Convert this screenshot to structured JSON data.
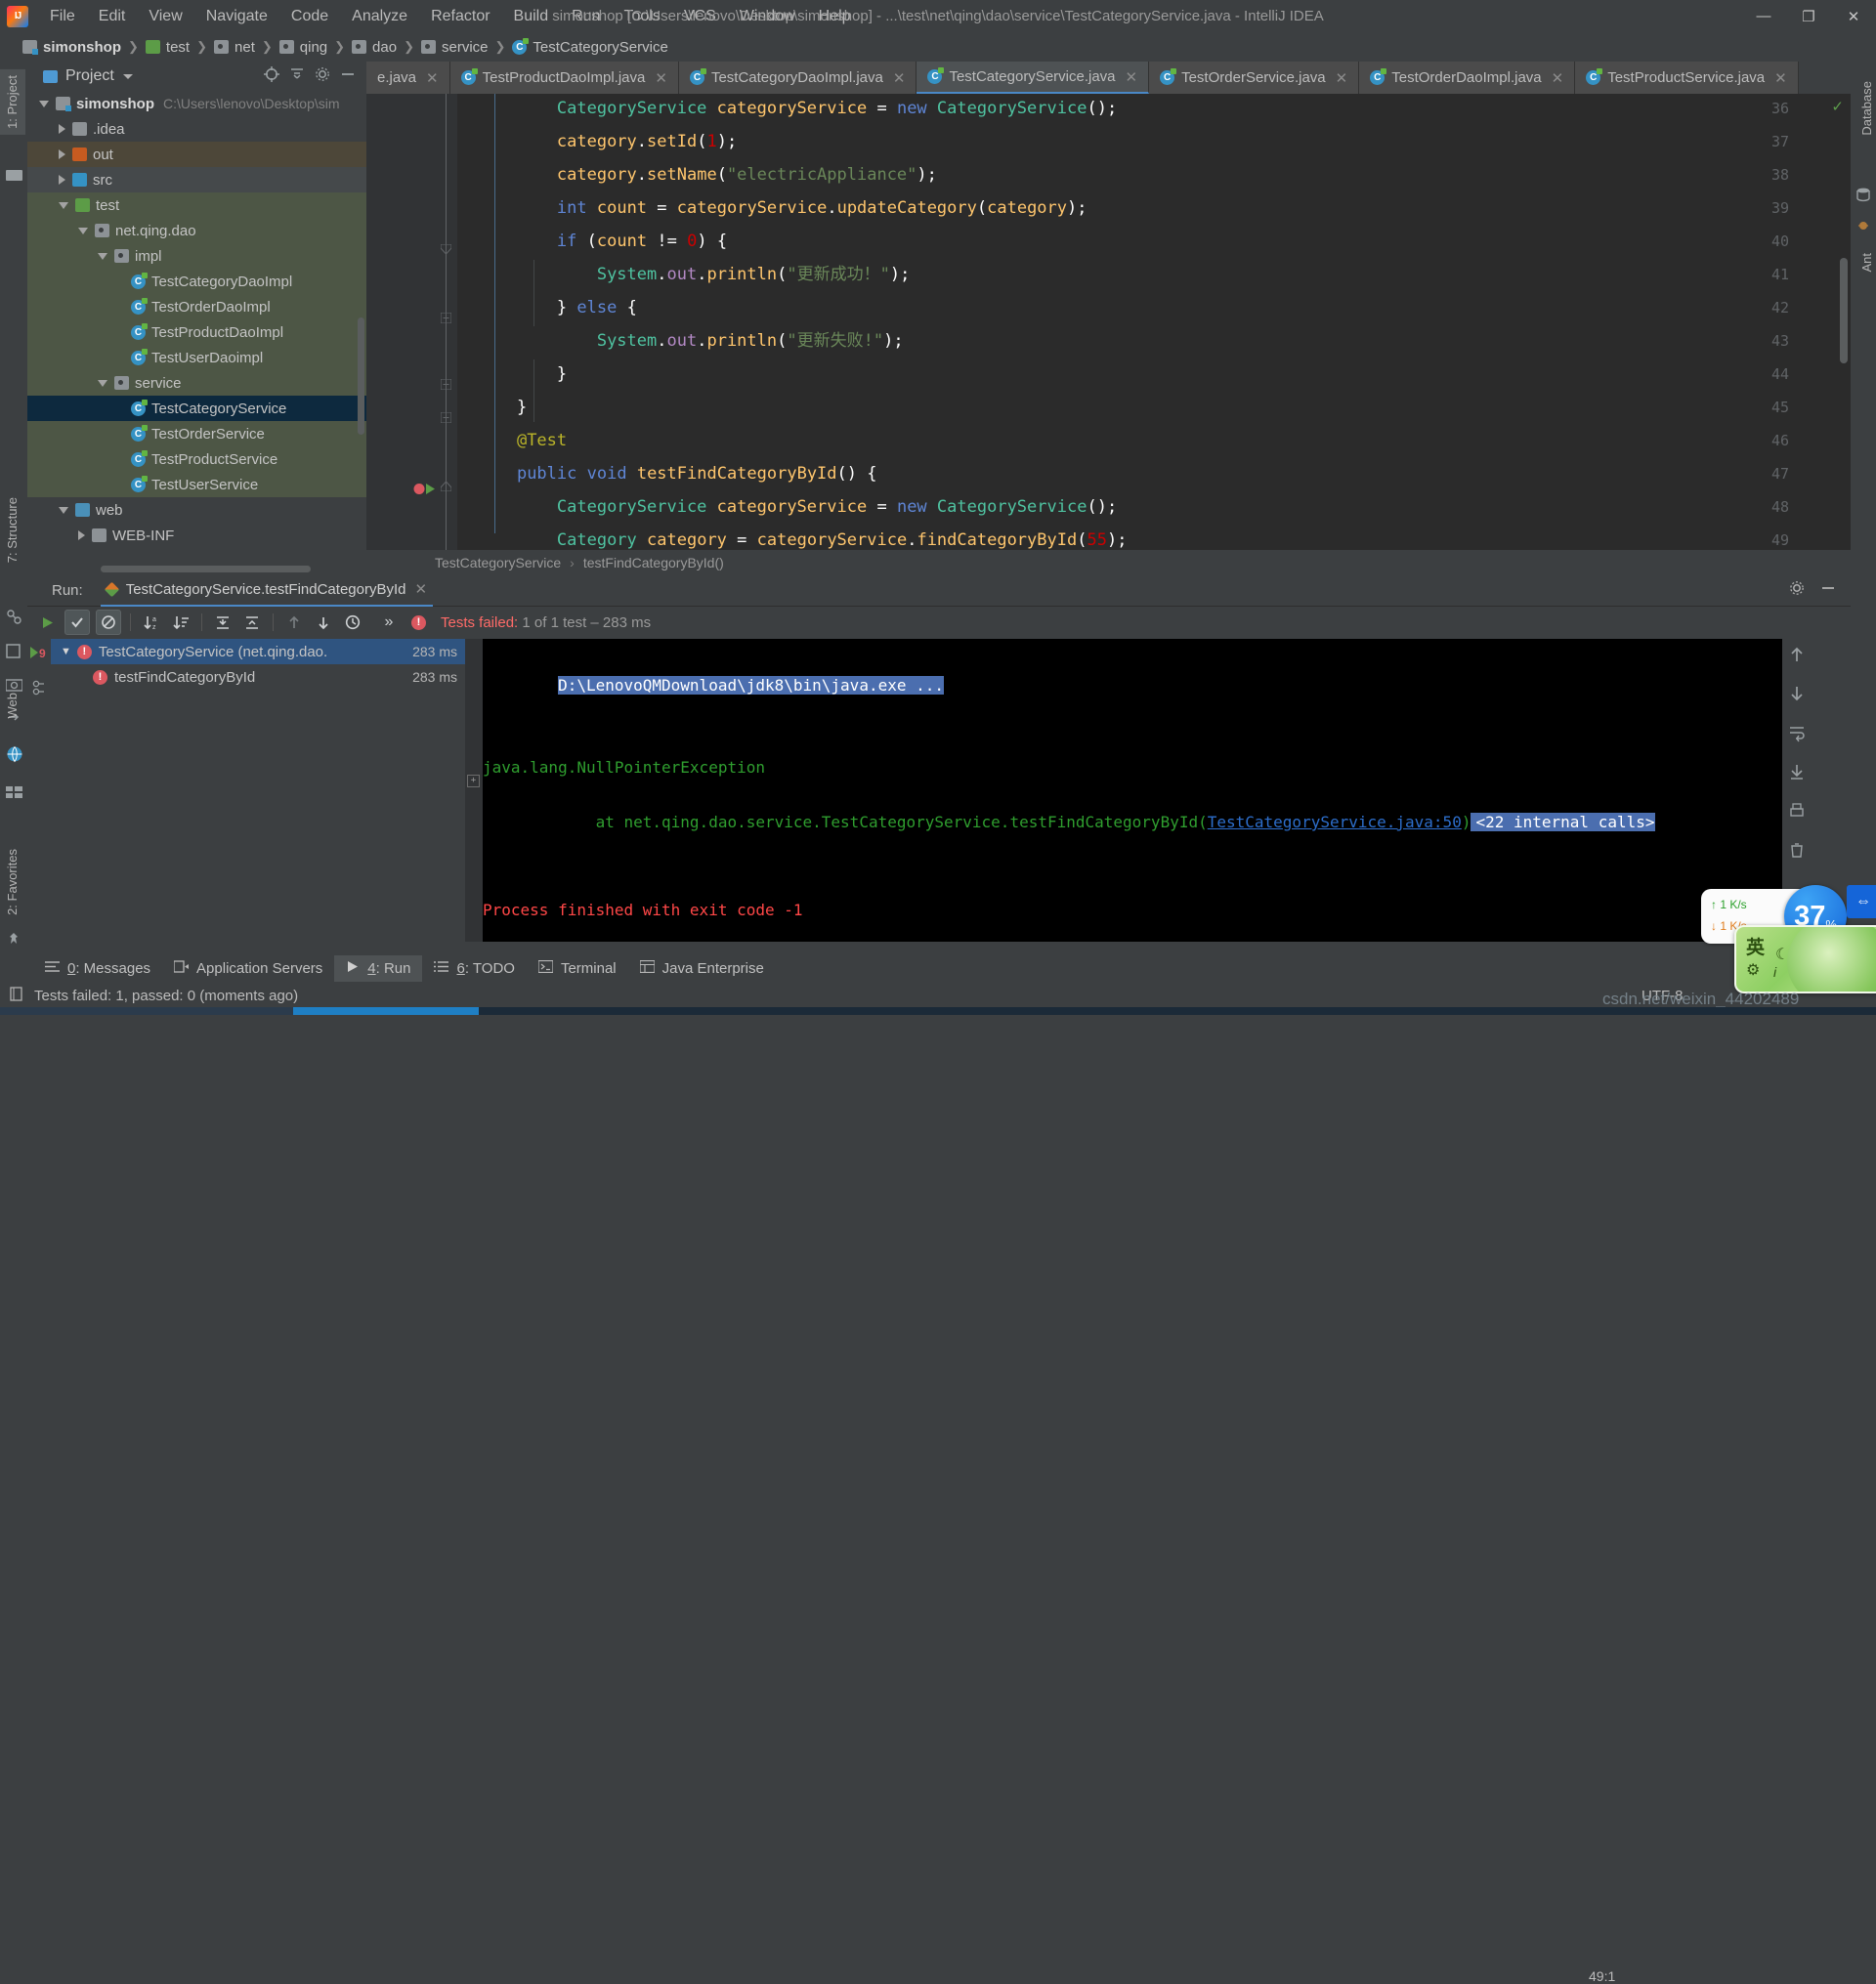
{
  "window": {
    "title": "simonshop [C:\\Users\\lenovo\\Desktop\\simonshop] - ...\\test\\net\\qing\\dao\\service\\TestCategoryService.java - IntelliJ IDEA",
    "minimize": "—",
    "maximize": "❐",
    "close": "✕"
  },
  "menu": [
    {
      "label": "File"
    },
    {
      "label": "Edit"
    },
    {
      "label": "View"
    },
    {
      "label": "Navigate"
    },
    {
      "label": "Code"
    },
    {
      "label": "Analyze"
    },
    {
      "label": "Refactor"
    },
    {
      "label": "Build"
    },
    {
      "label": "Run"
    },
    {
      "label": "Tools"
    },
    {
      "label": "VCS"
    },
    {
      "label": "Window"
    },
    {
      "label": "Help"
    }
  ],
  "breadcrumb": [
    {
      "label": "simonshop",
      "icon": "module-folder-icon"
    },
    {
      "label": "test",
      "icon": "test-source-folder-icon"
    },
    {
      "label": "net",
      "icon": "package-icon"
    },
    {
      "label": "qing",
      "icon": "package-icon"
    },
    {
      "label": "dao",
      "icon": "package-icon"
    },
    {
      "label": "service",
      "icon": "package-icon"
    },
    {
      "label": "TestCategoryService",
      "icon": "java-class-icon"
    }
  ],
  "run_config": {
    "name": "TestCategoryService.testFindCategoryById",
    "dropdown_arrow": "▾"
  },
  "project_panel": {
    "title": "Project",
    "caret": "▾",
    "tree": [
      {
        "label": "simonshop",
        "path": "C:\\Users\\lenovo\\Desktop\\sim",
        "indent": 0,
        "state": "open",
        "icon": "module-folder-icon",
        "bold": true,
        "hl": ""
      },
      {
        "label": ".idea",
        "path": "",
        "indent": 1,
        "state": "closed",
        "icon": "folder-icon",
        "bold": false,
        "hl": ""
      },
      {
        "label": "out",
        "path": "",
        "indent": 1,
        "state": "closed",
        "icon": "folder-out-icon",
        "bold": false,
        "hl": "hl-out"
      },
      {
        "label": "src",
        "path": "",
        "indent": 1,
        "state": "closed",
        "icon": "folder-src-icon",
        "bold": false,
        "hl": "hl-src"
      },
      {
        "label": "test",
        "path": "",
        "indent": 1,
        "state": "open",
        "icon": "folder-test-icon",
        "bold": false,
        "hl": "hl-test"
      },
      {
        "label": "net.qing.dao",
        "path": "",
        "indent": 2,
        "state": "open",
        "icon": "package-icon",
        "bold": false,
        "hl": "hl-test"
      },
      {
        "label": "impl",
        "path": "",
        "indent": 3,
        "state": "open",
        "icon": "package-icon",
        "bold": false,
        "hl": "hl-test"
      },
      {
        "label": "TestCategoryDaoImpl",
        "path": "",
        "indent": 4,
        "state": "none",
        "icon": "java-class-icon",
        "bold": false,
        "hl": "hl-test"
      },
      {
        "label": "TestOrderDaoImpl",
        "path": "",
        "indent": 4,
        "state": "none",
        "icon": "java-class-icon",
        "bold": false,
        "hl": "hl-test"
      },
      {
        "label": "TestProductDaoImpl",
        "path": "",
        "indent": 4,
        "state": "none",
        "icon": "java-class-icon",
        "bold": false,
        "hl": "hl-test"
      },
      {
        "label": "TestUserDaoimpl",
        "path": "",
        "indent": 4,
        "state": "none",
        "icon": "java-class-icon",
        "bold": false,
        "hl": "hl-test"
      },
      {
        "label": "service",
        "path": "",
        "indent": 3,
        "state": "open",
        "icon": "package-icon",
        "bold": false,
        "hl": "hl-test"
      },
      {
        "label": "TestCategoryService",
        "path": "",
        "indent": 4,
        "state": "none",
        "icon": "java-class-icon",
        "bold": false,
        "hl": "sel"
      },
      {
        "label": "TestOrderService",
        "path": "",
        "indent": 4,
        "state": "none",
        "icon": "java-class-icon",
        "bold": false,
        "hl": "hl-test"
      },
      {
        "label": "TestProductService",
        "path": "",
        "indent": 4,
        "state": "none",
        "icon": "java-class-icon",
        "bold": false,
        "hl": "hl-test"
      },
      {
        "label": "TestUserService",
        "path": "",
        "indent": 4,
        "state": "none",
        "icon": "java-class-icon",
        "bold": false,
        "hl": "hl-test"
      },
      {
        "label": "web",
        "path": "",
        "indent": 1,
        "state": "open",
        "icon": "folder-web-icon",
        "bold": false,
        "hl": ""
      },
      {
        "label": "WEB-INF",
        "path": "",
        "indent": 2,
        "state": "closed",
        "icon": "folder-icon",
        "bold": false,
        "hl": ""
      }
    ]
  },
  "editor_tabs": [
    {
      "label": "e.java",
      "active": false,
      "truncated": true
    },
    {
      "label": "TestProductDaoImpl.java",
      "active": false,
      "truncated": false
    },
    {
      "label": "TestCategoryDaoImpl.java",
      "active": false,
      "truncated": false
    },
    {
      "label": "TestCategoryService.java",
      "active": true,
      "truncated": false
    },
    {
      "label": "TestOrderService.java",
      "active": false,
      "truncated": false
    },
    {
      "label": "TestOrderDaoImpl.java",
      "active": false,
      "truncated": false
    },
    {
      "label": "TestProductService.java",
      "active": false,
      "truncated": true
    }
  ],
  "editor": {
    "lines": [
      {
        "num": "36",
        "text": "        CategoryService categoryService = new CategoryService();"
      },
      {
        "num": "37",
        "text": "        category.setId(1);"
      },
      {
        "num": "38",
        "text": "        category.setName(\"electricAppliance\");"
      },
      {
        "num": "39",
        "text": "        int count = categoryService.updateCategory(category);"
      },
      {
        "num": "40",
        "text": "        if (count != 0) {"
      },
      {
        "num": "41",
        "text": "            System.out.println(\"更新成功！\");"
      },
      {
        "num": "42",
        "text": "        } else {"
      },
      {
        "num": "43",
        "text": "            System.out.println(\"更新失败!\");"
      },
      {
        "num": "44",
        "text": "        }"
      },
      {
        "num": "45",
        "text": "    }"
      },
      {
        "num": "46",
        "text": "    @Test"
      },
      {
        "num": "47",
        "text": "    public void testFindCategoryById() {"
      },
      {
        "num": "48",
        "text": "        CategoryService categoryService = new CategoryService();"
      },
      {
        "num": "49",
        "text": "        Category category = categoryService.findCategoryById(55);"
      }
    ],
    "breadcrumb_bottom": [
      "TestCategoryService",
      "testFindCategoryById()"
    ],
    "breadcrumb_sep": "›"
  },
  "run_panel": {
    "run_label": "Run:",
    "tab_label": "TestCategoryService.testFindCategoryById",
    "close_x": "✕",
    "status": {
      "prefix": "Tests failed: ",
      "count": "1",
      "suffix": " of 1 test – 283 ms"
    },
    "toolbar_icons": [
      {
        "name": "rerun-icon",
        "glyph": "▶"
      },
      {
        "name": "show-passed-icon",
        "glyph": "✓"
      },
      {
        "name": "show-ignored-icon",
        "glyph": "⊘"
      },
      {
        "name": "sort-alphabetically-icon",
        "glyph": "↓"
      },
      {
        "name": "sort-by-duration-icon",
        "glyph": "↓"
      },
      {
        "name": "expand-all-icon",
        "glyph": "⇲"
      },
      {
        "name": "collapse-all-icon",
        "glyph": "⇱"
      },
      {
        "name": "previous-failed-icon",
        "glyph": "↑"
      },
      {
        "name": "next-failed-icon",
        "glyph": "↓"
      },
      {
        "name": "test-history-icon",
        "glyph": "⧖"
      },
      {
        "name": "more-options-icon",
        "glyph": "»"
      }
    ],
    "tests": [
      {
        "label": "TestCategoryService (net.qing.dao.",
        "ms": "283 ms",
        "selected": true,
        "arrow": "▼"
      },
      {
        "label": "testFindCategoryById",
        "ms": "283 ms",
        "selected": false,
        "arrow": ""
      }
    ],
    "console": [
      {
        "text": "D:\\LenovoQMDownload\\jdk8\\bin\\java.exe ...",
        "style": "selected"
      },
      {
        "text": "java.lang.NullPointerException",
        "style": "green"
      },
      {
        "text": "    at net.qing.dao.service.TestCategoryService.testFindCategoryById(",
        "link": "TestCategoryService.java:50",
        "after": ")",
        "tail": "<22 internal calls>",
        "style": "green-link"
      },
      {
        "text": "Process finished with exit code -1",
        "style": "red"
      }
    ]
  },
  "bottom_bar": [
    {
      "num": "0",
      "label": ": Messages",
      "icon": "messages-icon",
      "active": false
    },
    {
      "num": "",
      "label": "Application Servers",
      "icon": "app-servers-icon",
      "active": false
    },
    {
      "num": "4",
      "label": ": Run",
      "icon": "run-icon",
      "active": true
    },
    {
      "num": "6",
      "label": ": TODO",
      "icon": "todo-icon",
      "active": false
    },
    {
      "num": "",
      "label": "Terminal",
      "icon": "terminal-icon",
      "active": false
    },
    {
      "num": "",
      "label": "Java Enterprise",
      "icon": "java-enterprise-icon",
      "active": false
    }
  ],
  "status_bar": {
    "text": "Tests failed: 1, passed: 0 (moments ago)",
    "encoding": "UTF-8",
    "line_col": "49:1"
  },
  "left_strip": [
    {
      "label": "1: Project",
      "active": true
    },
    {
      "label": "7: Structure",
      "active": false
    },
    {
      "label": "Web",
      "active": false
    },
    {
      "label": "2: Favorites",
      "active": false
    }
  ],
  "right_strip": [
    {
      "label": "Database",
      "active": false
    },
    {
      "label": "Ant",
      "active": false
    }
  ],
  "tray": {
    "net_up": "↑ 1   K/s",
    "net_down": "↓ 1   K/s",
    "cpu_value": "37",
    "cpu_unit": "%",
    "ime_lang": "英",
    "ime_moon": "☾",
    "ime_gear": "⚙",
    "ime_dot": "i",
    "blue_glyph": "⇔"
  },
  "watermark": "csdn.net/weixin_44202489"
}
